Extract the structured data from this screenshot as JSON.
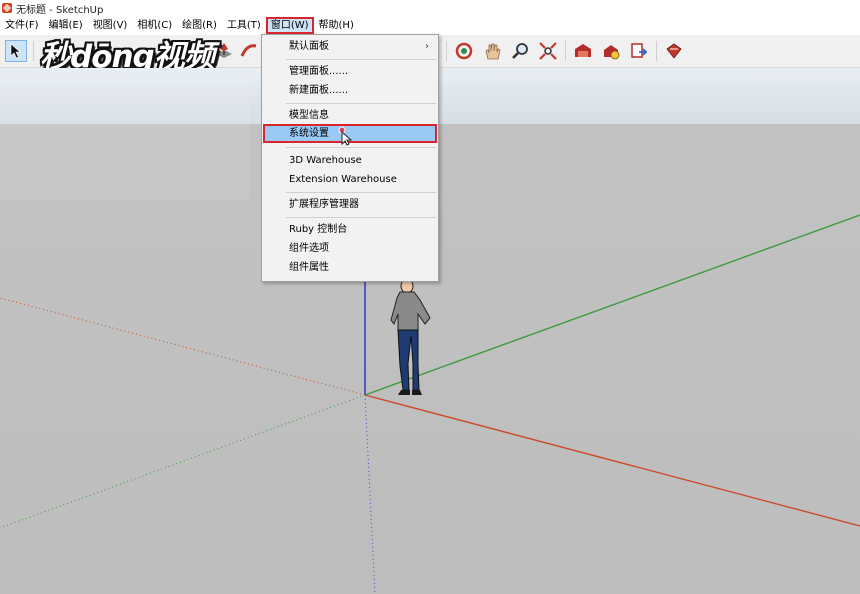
{
  "window": {
    "title": "无标题 - SketchUp"
  },
  "menubar": {
    "items": [
      {
        "id": "file",
        "label": "文件(F)"
      },
      {
        "id": "edit",
        "label": "编辑(E)"
      },
      {
        "id": "view",
        "label": "视图(V)"
      },
      {
        "id": "camera",
        "label": "相机(C)"
      },
      {
        "id": "draw",
        "label": "绘图(R)"
      },
      {
        "id": "tools",
        "label": "工具(T)"
      },
      {
        "id": "window",
        "label": "窗口(W)",
        "active": true
      },
      {
        "id": "help",
        "label": "帮助(H)"
      }
    ]
  },
  "watermark": {
    "text": "秒dōng视频"
  },
  "window_menu": {
    "items": [
      {
        "label": "默认面板",
        "has_submenu": true,
        "submenu_glyph": "›"
      },
      {
        "label": "管理面板......"
      },
      {
        "label": "新建面板......"
      },
      {
        "label": "模型信息"
      },
      {
        "label": "系统设置",
        "highlighted": true
      },
      {
        "label": "3D Warehouse"
      },
      {
        "label": "Extension Warehouse"
      },
      {
        "label": "扩展程序管理器"
      },
      {
        "label": "Ruby 控制台"
      },
      {
        "label": "组件选项"
      },
      {
        "label": "组件属性"
      }
    ]
  },
  "colors": {
    "highlight_border": "#d9262c",
    "menu_highlight": "#99c9f4",
    "axis_red": "#cc4a2a",
    "axis_green": "#3e9a3e",
    "axis_blue": "#2a2ad0"
  },
  "toolbar": {
    "icons": [
      "select-arrow-icon",
      "paint-bucket-icon",
      "push-pull-icon",
      "follow-me-icon",
      "orbit-icon",
      "pan-hand-icon",
      "zoom-icon",
      "zoom-extents-icon",
      "warehouse-icon",
      "share-model-icon",
      "send-to-layout-icon",
      "extension-warehouse-icon"
    ]
  }
}
